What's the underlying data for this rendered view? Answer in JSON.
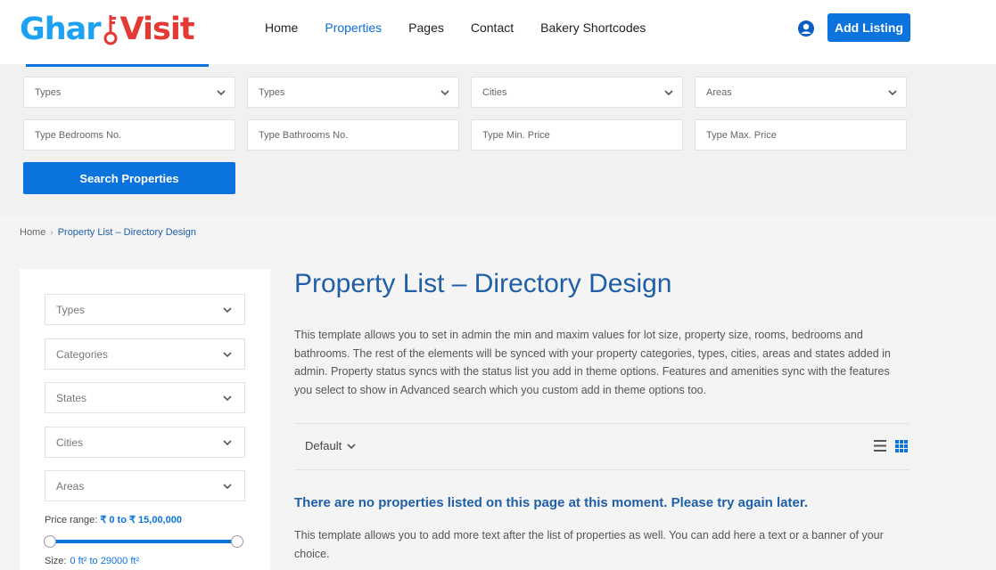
{
  "brand": {
    "logo_part1": "Ghar",
    "logo_part2": "Visit"
  },
  "nav": {
    "items": [
      "Home",
      "Properties",
      "Pages",
      "Contact",
      "Bakery Shortcodes"
    ],
    "active": "Properties"
  },
  "header": {
    "add_listing_label": "Add Listing",
    "user_icon": "user-circle-icon"
  },
  "search": {
    "selects": [
      "Types",
      "Types",
      "Cities",
      "Areas"
    ],
    "inputs": [
      "Type Bedrooms No.",
      "Type Bathrooms No.",
      "Type Min. Price",
      "Type Max. Price"
    ],
    "button_label": "Search Properties"
  },
  "breadcrumb": {
    "home": "Home",
    "current": "Property List – Directory Design"
  },
  "sidebar": {
    "filters": [
      "Types",
      "Categories",
      "States",
      "Cities",
      "Areas"
    ],
    "price_label": "Price range:",
    "price_value": "₹ 0 to ₹ 15,00,000",
    "size_label": "Size:",
    "size_value_html": "0 ft² to 29000 ft²"
  },
  "main": {
    "title": "Property List – Directory Design",
    "intro": "This template allows you to set in admin the min and maxim values for lot size, property size, rooms, bedrooms and bathrooms. The rest of the elements will be synced with your property categories, types, cities, areas and states added in admin. Property status syncs with the status list you add in theme options. Features and amenities sync with the features you select to show in Advanced search which you custom add in theme options too.",
    "sort_label": "Default",
    "no_properties": "There are no properties listed on this page at this moment. Please try again later.",
    "outro": "This template allows you to add more text after the list of properties as well. You can add here a text or a banner of your choice."
  },
  "colors": {
    "accent": "#0b73de",
    "title": "#1f5fa8",
    "logo_blue": "#1da1f2",
    "logo_red": "#e53935"
  }
}
